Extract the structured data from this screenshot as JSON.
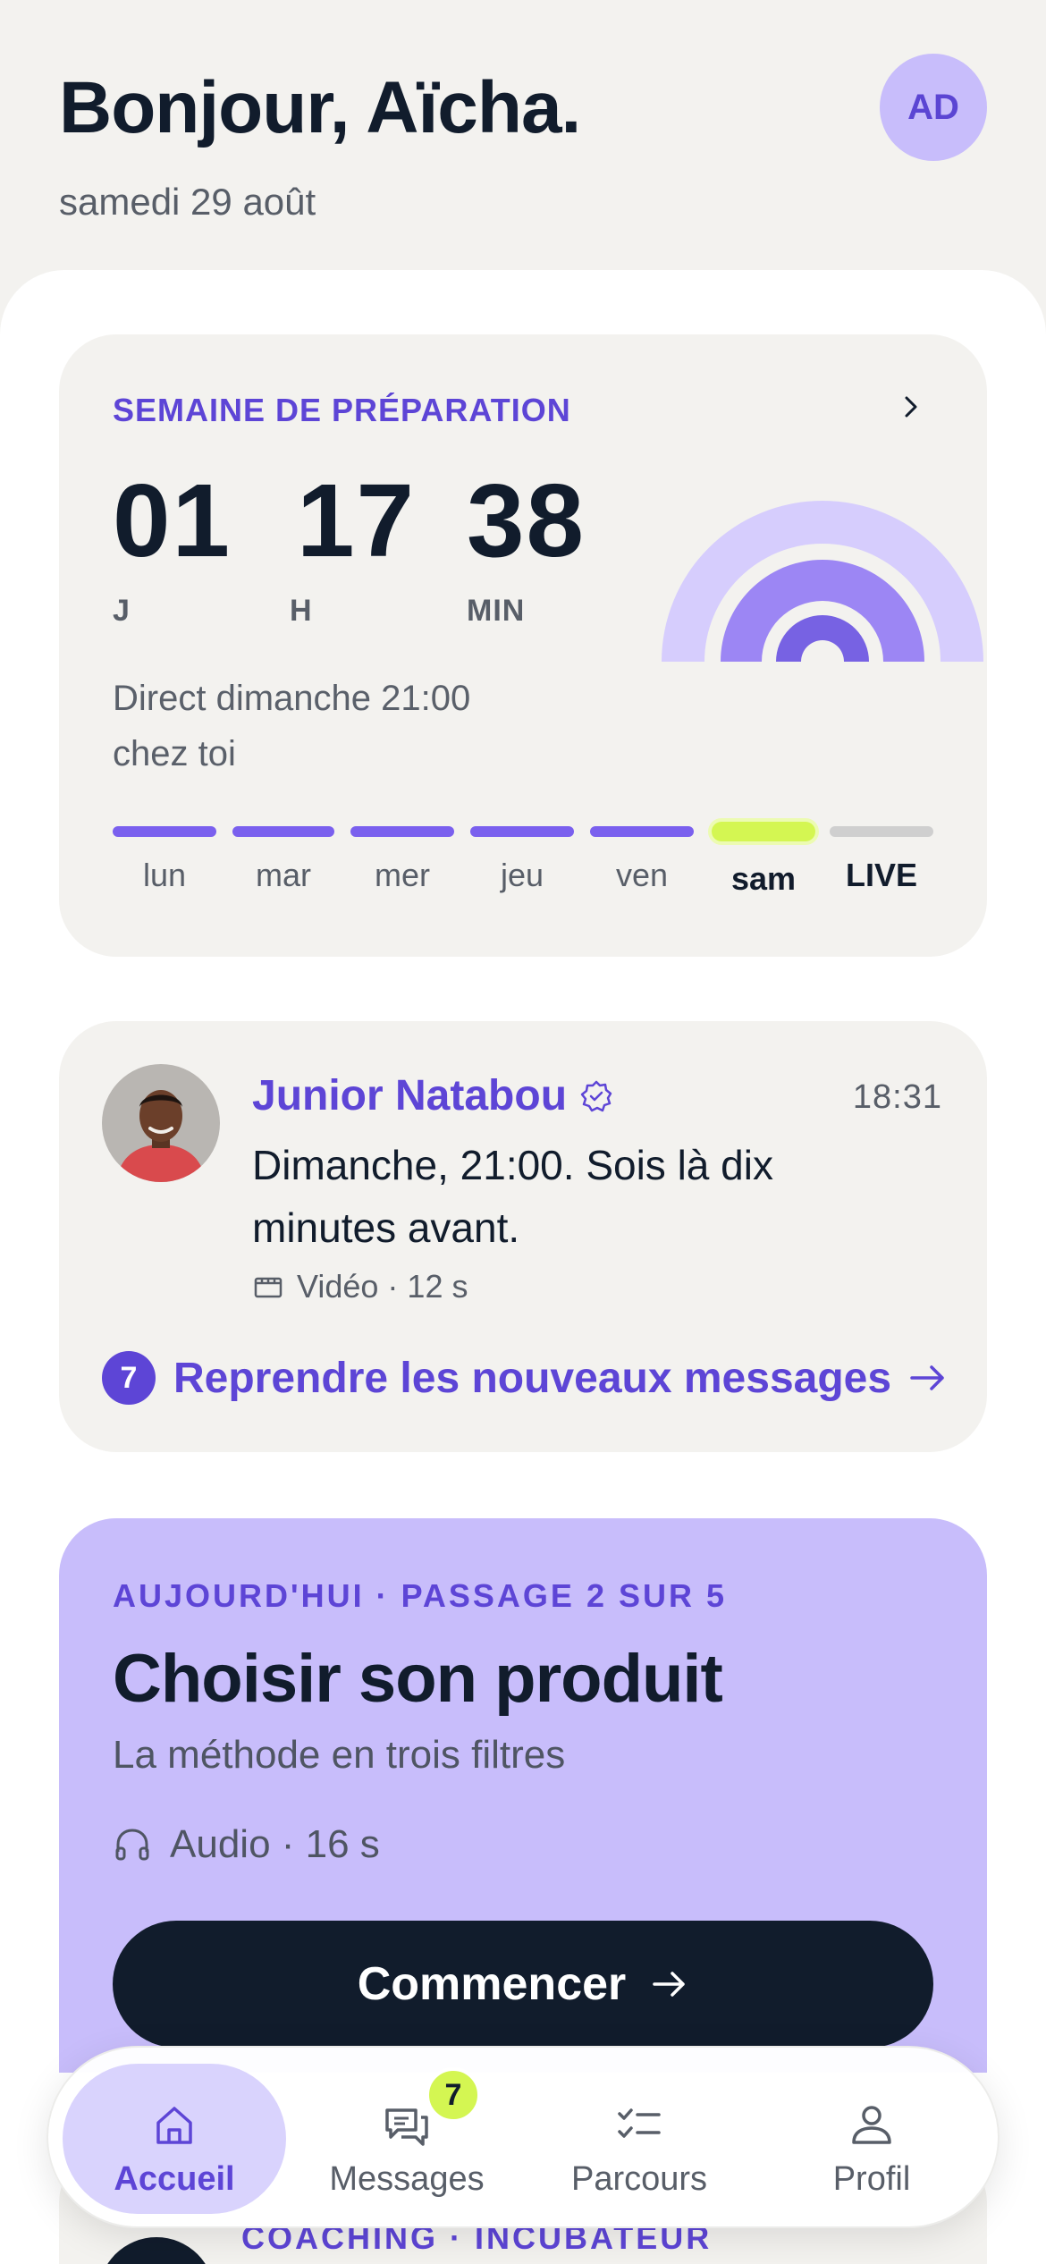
{
  "header": {
    "greeting": "Bonjour, Aïcha.",
    "date": "samedi 29 août",
    "avatar_initials": "AD"
  },
  "countdown": {
    "eyebrow": "SEMAINE DE PRÉPARATION",
    "days": "01",
    "days_unit": "J",
    "hours": "17",
    "hours_unit": "H",
    "minutes": "38",
    "minutes_unit": "MIN",
    "direct_line1": "Direct dimanche 21:00",
    "direct_line2": "chez toi",
    "week": [
      {
        "label": "lun",
        "state": "done"
      },
      {
        "label": "mar",
        "state": "done"
      },
      {
        "label": "mer",
        "state": "done"
      },
      {
        "label": "jeu",
        "state": "done"
      },
      {
        "label": "ven",
        "state": "done"
      },
      {
        "label": "sam",
        "state": "today"
      },
      {
        "label": "LIVE",
        "state": "upcoming"
      }
    ],
    "colors": {
      "ring_outer": "#d6cdfd",
      "ring_mid": "#9c86f4",
      "ring_inner": "#7762e3",
      "today": "#d4f652"
    }
  },
  "message": {
    "sender": "Junior Natabou",
    "time": "18:31",
    "text": "Dimanche, 21:00. Sois là dix minutes avant.",
    "media": "Vidéo · 12 s",
    "new_count": "7",
    "resume_label": "Reprendre les nouveaux messages",
    "icons": [
      "verified-badge-icon",
      "video-icon",
      "arrow-right-icon"
    ]
  },
  "lesson": {
    "eyebrow": "AUJOURD'HUI · PASSAGE 2 SUR 5",
    "title": "Choisir son produit",
    "subtitle": "La méthode en trois filtres",
    "media": "Audio · 16 s",
    "cta": "Commencer"
  },
  "peek": {
    "eyebrow": "COACHING · INCUBATEUR"
  },
  "nav": {
    "items": [
      {
        "label": "Accueil",
        "icon": "home-icon",
        "active": true
      },
      {
        "label": "Messages",
        "icon": "chat-icon",
        "badge": "7"
      },
      {
        "label": "Parcours",
        "icon": "checklist-icon"
      },
      {
        "label": "Profil",
        "icon": "person-icon"
      }
    ]
  },
  "colors": {
    "accent": "#5d45d6",
    "dark": "#111c2c",
    "lesson_bg": "#c8bdfb",
    "card_bg": "#f3f2ef"
  }
}
